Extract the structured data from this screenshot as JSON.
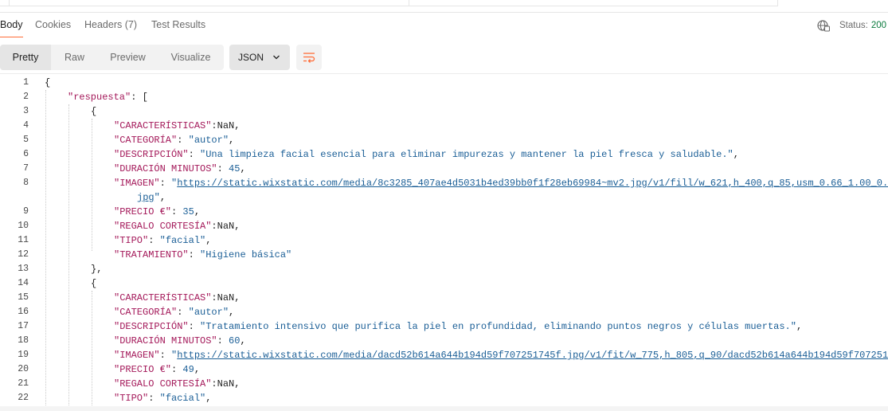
{
  "response_tabs": [
    "Body",
    "Cookies",
    "Headers (7)",
    "Test Results"
  ],
  "status": {
    "label": "Status:",
    "value": "200"
  },
  "view_modes": [
    "Pretty",
    "Raw",
    "Preview",
    "Visualize"
  ],
  "format": {
    "selected": "JSON"
  },
  "colors": {
    "accent": "#ff6c37",
    "key": "#a4195a",
    "string": "#1a5e96",
    "status_ok": "#0a7a3d"
  },
  "lines": [
    {
      "n": "1",
      "indent": 0,
      "parts": [
        [
          "p",
          "{"
        ]
      ]
    },
    {
      "n": "2",
      "indent": 1,
      "parts": [
        [
          "k",
          "\"respuesta\""
        ],
        [
          "p",
          ": ["
        ]
      ]
    },
    {
      "n": "3",
      "indent": 2,
      "parts": [
        [
          "p",
          "{"
        ]
      ]
    },
    {
      "n": "4",
      "indent": 3,
      "parts": [
        [
          "k",
          "\"CARACTERÍSTICAS\""
        ],
        [
          "p",
          ":NaN,"
        ]
      ]
    },
    {
      "n": "5",
      "indent": 3,
      "parts": [
        [
          "k",
          "\"CATEGORÍA\""
        ],
        [
          "p",
          ": "
        ],
        [
          "s",
          "\"autor\""
        ],
        [
          "p",
          ","
        ]
      ]
    },
    {
      "n": "6",
      "indent": 3,
      "parts": [
        [
          "k",
          "\"DESCRIPCIÓN\""
        ],
        [
          "p",
          ": "
        ],
        [
          "s",
          "\"Una limpieza facial esencial para eliminar impurezas y mantener la piel fresca y saludable.\""
        ],
        [
          "p",
          ","
        ]
      ]
    },
    {
      "n": "7",
      "indent": 3,
      "parts": [
        [
          "k",
          "\"DURACIÓN MINUTOS\""
        ],
        [
          "p",
          ": "
        ],
        [
          "n",
          "45"
        ],
        [
          "p",
          ","
        ]
      ]
    },
    {
      "n": "8",
      "indent": 3,
      "parts": [
        [
          "k",
          "\"IMAGEN\""
        ],
        [
          "p",
          ": "
        ],
        [
          "s",
          "\""
        ],
        [
          "link",
          "https://static.wixstatic.com/media/8c3285_407ae4d5031b4ed39bb0f1f28eb69984~mv2.jpg/v1/fill/w_621,h_400,q_85,usm_0.66_1.00_0.01"
        ]
      ]
    },
    {
      "n": "",
      "indent": 4,
      "parts": [
        [
          "link",
          "jpg"
        ],
        [
          "s",
          "\""
        ],
        [
          "p",
          ","
        ]
      ]
    },
    {
      "n": "9",
      "indent": 3,
      "parts": [
        [
          "k",
          "\"PRECIO €\""
        ],
        [
          "p",
          ": "
        ],
        [
          "n",
          "35"
        ],
        [
          "p",
          ","
        ]
      ]
    },
    {
      "n": "10",
      "indent": 3,
      "parts": [
        [
          "k",
          "\"REGALO CORTESÍA\""
        ],
        [
          "p",
          ":NaN,"
        ]
      ]
    },
    {
      "n": "11",
      "indent": 3,
      "parts": [
        [
          "k",
          "\"TIPO\""
        ],
        [
          "p",
          ": "
        ],
        [
          "s",
          "\"facial\""
        ],
        [
          "p",
          ","
        ]
      ]
    },
    {
      "n": "12",
      "indent": 3,
      "parts": [
        [
          "k",
          "\"TRATAMIENTO\""
        ],
        [
          "p",
          ": "
        ],
        [
          "s",
          "\"Higiene básica\""
        ]
      ]
    },
    {
      "n": "13",
      "indent": 2,
      "parts": [
        [
          "p",
          "},"
        ]
      ]
    },
    {
      "n": "14",
      "indent": 2,
      "parts": [
        [
          "p",
          "{"
        ]
      ]
    },
    {
      "n": "15",
      "indent": 3,
      "parts": [
        [
          "k",
          "\"CARACTERÍSTICAS\""
        ],
        [
          "p",
          ":NaN,"
        ]
      ]
    },
    {
      "n": "16",
      "indent": 3,
      "parts": [
        [
          "k",
          "\"CATEGORÍA\""
        ],
        [
          "p",
          ": "
        ],
        [
          "s",
          "\"autor\""
        ],
        [
          "p",
          ","
        ]
      ]
    },
    {
      "n": "17",
      "indent": 3,
      "parts": [
        [
          "k",
          "\"DESCRIPCIÓN\""
        ],
        [
          "p",
          ": "
        ],
        [
          "s",
          "\"Tratamiento intensivo que purifica la piel en profundidad, eliminando puntos negros y células muertas.\""
        ],
        [
          "p",
          ","
        ]
      ]
    },
    {
      "n": "18",
      "indent": 3,
      "parts": [
        [
          "k",
          "\"DURACIÓN MINUTOS\""
        ],
        [
          "p",
          ": "
        ],
        [
          "n",
          "60"
        ],
        [
          "p",
          ","
        ]
      ]
    },
    {
      "n": "19",
      "indent": 3,
      "parts": [
        [
          "k",
          "\"IMAGEN\""
        ],
        [
          "p",
          ": "
        ],
        [
          "s",
          "\""
        ],
        [
          "link",
          "https://static.wixstatic.com/media/dacd52b614a644b194d59f707251745f.jpg/v1/fit/w_775,h_805,q_90/dacd52b614a644b194d59f707251745f.jpg"
        ]
      ]
    },
    {
      "n": "20",
      "indent": 3,
      "parts": [
        [
          "k",
          "\"PRECIO €\""
        ],
        [
          "p",
          ": "
        ],
        [
          "n",
          "49"
        ],
        [
          "p",
          ","
        ]
      ]
    },
    {
      "n": "21",
      "indent": 3,
      "parts": [
        [
          "k",
          "\"REGALO CORTESÍA\""
        ],
        [
          "p",
          ":NaN,"
        ]
      ]
    },
    {
      "n": "22",
      "indent": 3,
      "parts": [
        [
          "k",
          "\"TIPO\""
        ],
        [
          "p",
          ": "
        ],
        [
          "s",
          "\"facial\""
        ],
        [
          "p",
          ","
        ]
      ]
    }
  ]
}
